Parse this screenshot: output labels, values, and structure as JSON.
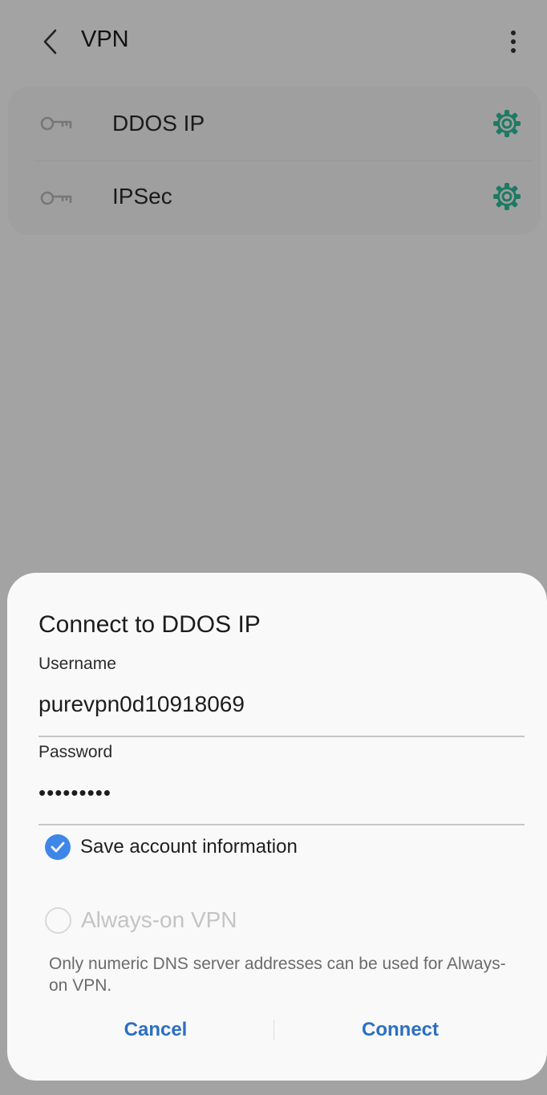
{
  "header": {
    "title": "VPN",
    "back_icon": "chevron-left-icon",
    "more_icon": "more-vertical-icon"
  },
  "vpn_list": [
    {
      "name": "DDOS IP",
      "icon": "key-icon",
      "settings_icon": "gear-icon"
    },
    {
      "name": "IPSec",
      "icon": "key-icon",
      "settings_icon": "gear-icon"
    }
  ],
  "dialog": {
    "title": "Connect to DDOS IP",
    "username_label": "Username",
    "username_value": "purevpn0d10918069",
    "password_label": "Password",
    "password_value": "•••••••••",
    "save_account_label": "Save account information",
    "save_account_checked": true,
    "always_on_label": "Always-on VPN",
    "always_on_enabled": false,
    "help_text": "Only numeric DNS server addresses can be used for Always-on VPN.",
    "cancel_label": "Cancel",
    "connect_label": "Connect"
  },
  "colors": {
    "overlay_bg": "#a3a3a3",
    "accent": "#2b6fc2",
    "checkbox": "#3e86e8",
    "gear": "#1f7a63"
  }
}
